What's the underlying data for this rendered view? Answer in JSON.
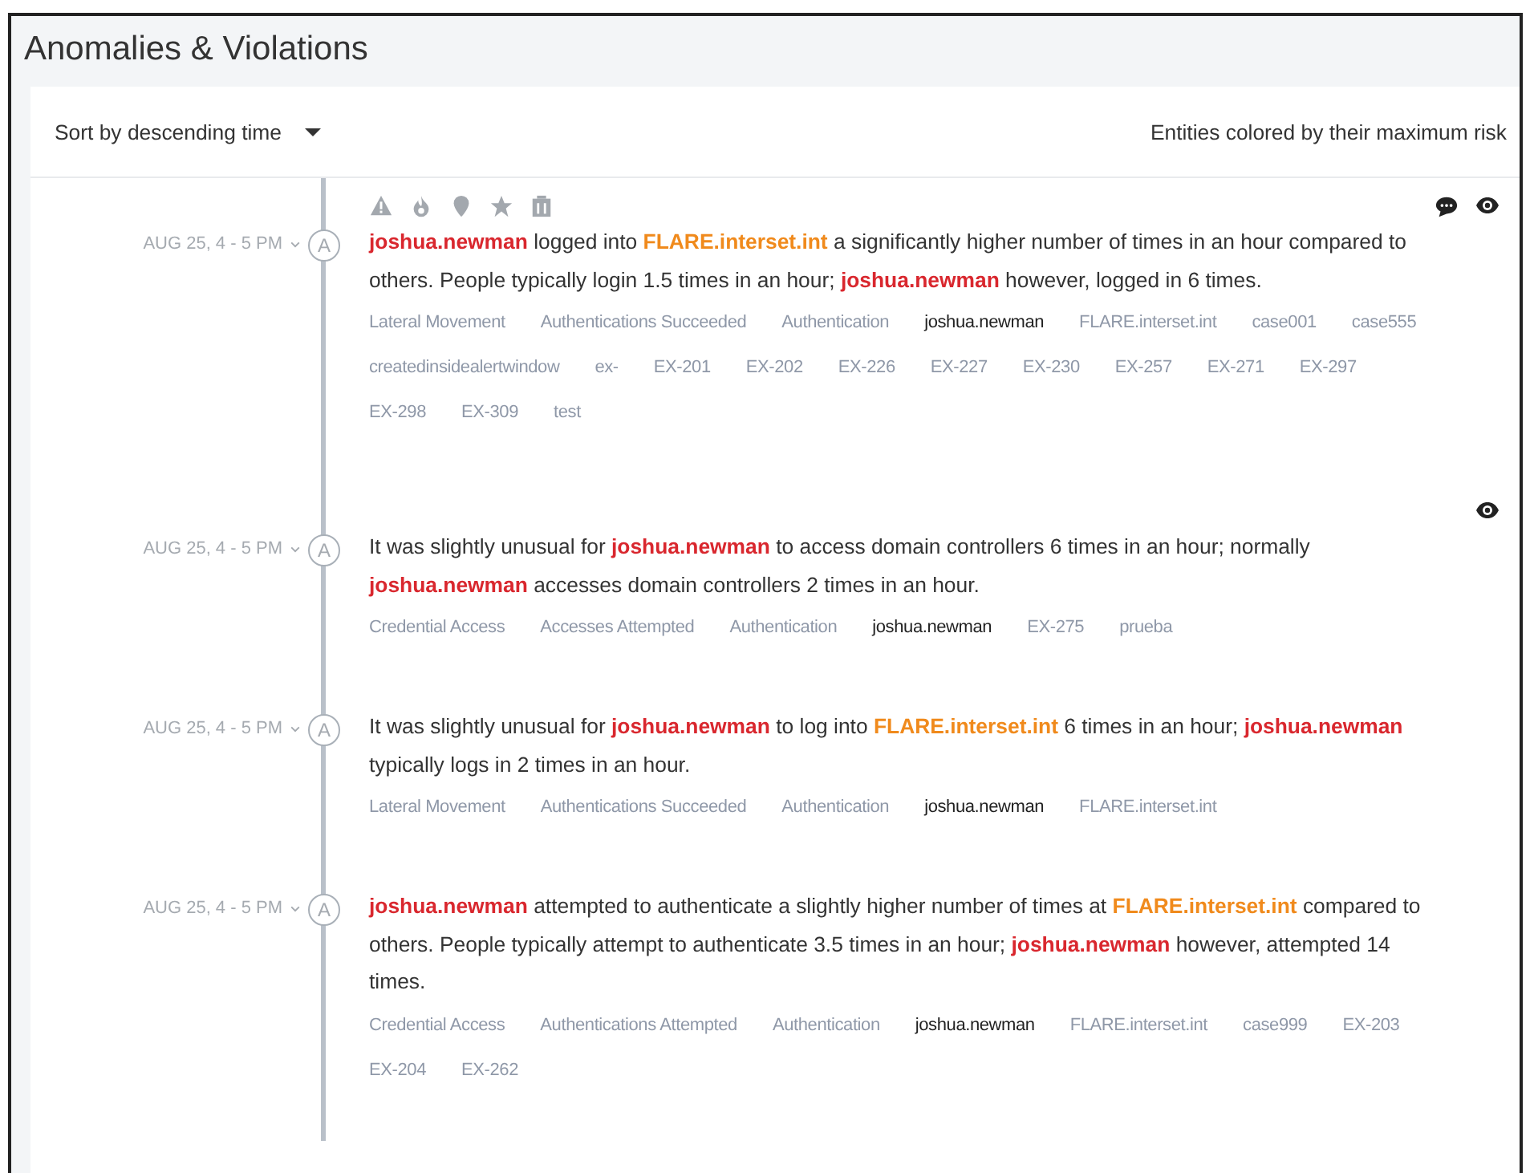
{
  "panel": {
    "title": "Anomalies & Violations"
  },
  "toolbar": {
    "sort": "Sort by descending time",
    "legend": "Entities colored by their maximum risk"
  },
  "alerts": [
    {
      "time": "AUG 25, 4 - 5 PM",
      "badge": "A",
      "indicators": true,
      "commented": true,
      "watched": true,
      "description": [
        {
          "text": "joshua.newman",
          "kind": "user"
        },
        {
          "text": " logged into ",
          "kind": "plain"
        },
        {
          "text": "FLARE.interset.int",
          "kind": "host"
        },
        {
          "text": " a significantly higher number of times in an hour compared to others. People typically login 1.5 times in an hour; ",
          "kind": "plain"
        },
        {
          "text": "joshua.newman",
          "kind": "user"
        },
        {
          "text": " however, logged in 6 times.",
          "kind": "plain"
        }
      ],
      "tags": [
        {
          "text": "Lateral Movement",
          "kind": "plain"
        },
        {
          "text": "Authentications Succeeded",
          "kind": "plain"
        },
        {
          "text": "Authentication",
          "kind": "plain"
        },
        {
          "text": "joshua.newman",
          "kind": "user"
        },
        {
          "text": "FLARE.interset.int",
          "kind": "plain"
        },
        {
          "text": "case001",
          "kind": "plain"
        },
        {
          "text": "case555",
          "kind": "plain"
        },
        {
          "text": "createdinsidealertwindow",
          "kind": "plain"
        },
        {
          "text": "ex-",
          "kind": "plain"
        },
        {
          "text": "EX-201",
          "kind": "plain"
        },
        {
          "text": "EX-202",
          "kind": "plain"
        },
        {
          "text": "EX-226",
          "kind": "plain"
        },
        {
          "text": "EX-227",
          "kind": "plain"
        },
        {
          "text": "EX-230",
          "kind": "plain"
        },
        {
          "text": "EX-257",
          "kind": "plain"
        },
        {
          "text": "EX-271",
          "kind": "plain"
        },
        {
          "text": "EX-297",
          "kind": "plain"
        },
        {
          "text": "EX-298",
          "kind": "plain"
        },
        {
          "text": "EX-309",
          "kind": "plain"
        },
        {
          "text": "test",
          "kind": "plain"
        }
      ]
    },
    {
      "time": "AUG 25, 4 - 5 PM",
      "badge": "A",
      "indicators": false,
      "commented": false,
      "watched": true,
      "description": [
        {
          "text": "It was slightly unusual for ",
          "kind": "plain"
        },
        {
          "text": "joshua.newman",
          "kind": "user"
        },
        {
          "text": " to access domain controllers 6 times in an hour; normally ",
          "kind": "plain"
        },
        {
          "text": "joshua.newman",
          "kind": "user"
        },
        {
          "text": " accesses domain controllers 2 times in an hour.",
          "kind": "plain"
        }
      ],
      "tags": [
        {
          "text": "Credential Access",
          "kind": "plain"
        },
        {
          "text": "Accesses Attempted",
          "kind": "plain"
        },
        {
          "text": "Authentication",
          "kind": "plain"
        },
        {
          "text": "joshua.newman",
          "kind": "user"
        },
        {
          "text": "EX-275",
          "kind": "plain"
        },
        {
          "text": "prueba",
          "kind": "plain"
        }
      ]
    },
    {
      "time": "AUG 25, 4 - 5 PM",
      "badge": "A",
      "indicators": false,
      "commented": false,
      "watched": false,
      "description": [
        {
          "text": "It was slightly unusual for ",
          "kind": "plain"
        },
        {
          "text": "joshua.newman",
          "kind": "user"
        },
        {
          "text": " to log into ",
          "kind": "plain"
        },
        {
          "text": "FLARE.interset.int",
          "kind": "host"
        },
        {
          "text": " 6 times in an hour; ",
          "kind": "plain"
        },
        {
          "text": "joshua.newman",
          "kind": "user"
        },
        {
          "text": " typically logs in 2 times in an hour.",
          "kind": "plain"
        }
      ],
      "tags": [
        {
          "text": "Lateral Movement",
          "kind": "plain"
        },
        {
          "text": "Authentications Succeeded",
          "kind": "plain"
        },
        {
          "text": "Authentication",
          "kind": "plain"
        },
        {
          "text": "joshua.newman",
          "kind": "user"
        },
        {
          "text": "FLARE.interset.int",
          "kind": "plain"
        }
      ]
    },
    {
      "time": "AUG 25, 4 - 5 PM",
      "badge": "A",
      "indicators": false,
      "commented": false,
      "watched": false,
      "description": [
        {
          "text": "joshua.newman",
          "kind": "user"
        },
        {
          "text": " attempted to authenticate a slightly higher number of times at ",
          "kind": "plain"
        },
        {
          "text": "FLARE.interset.int",
          "kind": "host"
        },
        {
          "text": " compared to others. People typically attempt to authenticate 3.5 times in an hour; ",
          "kind": "plain"
        },
        {
          "text": "joshua.newman",
          "kind": "user"
        },
        {
          "text": " however, attempted 14 times.",
          "kind": "plain"
        }
      ],
      "tags": [
        {
          "text": "Credential Access",
          "kind": "plain"
        },
        {
          "text": "Authentications Attempted",
          "kind": "plain"
        },
        {
          "text": "Authentication",
          "kind": "plain"
        },
        {
          "text": "joshua.newman",
          "kind": "user"
        },
        {
          "text": "FLARE.interset.int",
          "kind": "plain"
        },
        {
          "text": "case999",
          "kind": "plain"
        },
        {
          "text": "EX-203",
          "kind": "plain"
        },
        {
          "text": "EX-204",
          "kind": "plain"
        },
        {
          "text": "EX-262",
          "kind": "plain"
        }
      ]
    }
  ]
}
